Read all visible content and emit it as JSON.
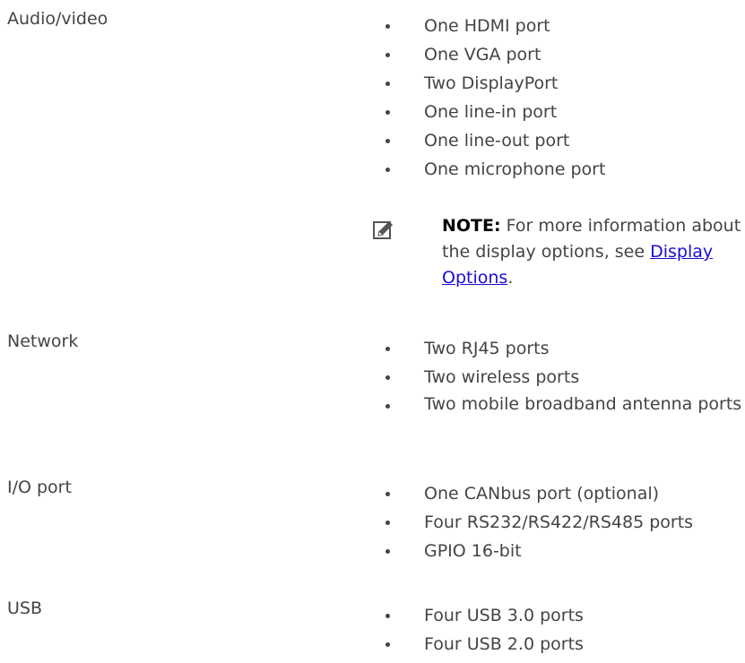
{
  "rows": [
    {
      "label": "Audio/video",
      "items": [
        "One HDMI port",
        "One VGA port",
        "Two DisplayPort",
        "One line-in port",
        "One line-out port",
        "One microphone port"
      ]
    },
    {
      "label": "Network",
      "items": [
        "Two RJ45 ports",
        "Two wireless ports",
        "Two mobile broadband antenna ports"
      ]
    },
    {
      "label": "I/O port",
      "items": [
        "One CANbus port (optional)",
        "Four RS232/RS422/RS485 ports",
        "GPIO 16-bit"
      ]
    },
    {
      "label": "USB",
      "items": [
        "Four USB 3.0 ports",
        "Four USB 2.0 ports"
      ]
    }
  ],
  "note": {
    "label": "NOTE:",
    "text": "For more information about the display options, see",
    "link_text": "Display Options",
    "suffix": ".",
    "icon": "pencil-note-icon"
  }
}
